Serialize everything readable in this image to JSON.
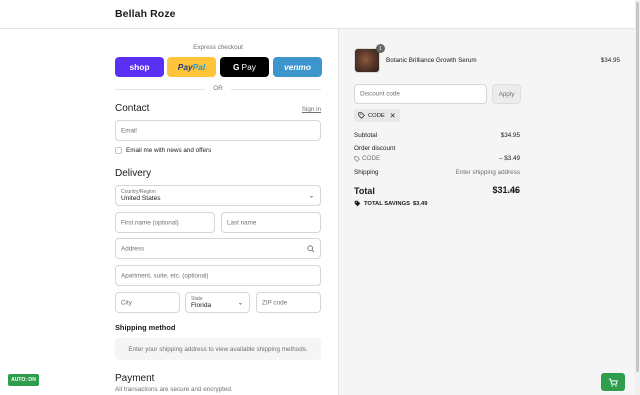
{
  "brand": "Bellah Roze",
  "express": {
    "label": "Express checkout",
    "shop": "shop",
    "paypal_pay": "Pay",
    "paypal_pal": "Pal",
    "gpay": "Pay",
    "venmo": "venmo",
    "or": "OR"
  },
  "contact": {
    "title": "Contact",
    "signin": "Sign in",
    "email_placeholder": "Email",
    "newsletter_label": "Email me with news and offers"
  },
  "delivery": {
    "title": "Delivery",
    "country_label": "Country/Region",
    "country_value": "United States",
    "first_name": "First name (optional)",
    "last_name": "Last name",
    "address": "Address",
    "apartment": "Apartment, suite, etc. (optional)",
    "city": "City",
    "state_label": "State",
    "state_value": "Florida",
    "zip": "ZIP code"
  },
  "shipping_method": {
    "title": "Shipping method",
    "message": "Enter your shipping address to view available shipping methods."
  },
  "payment": {
    "title": "Payment",
    "subtitle": "All transactions are secure and encrypted."
  },
  "auto_badge": "AUTO: ON",
  "summary": {
    "product": {
      "name": "Botanic Brilliance Growth Serum",
      "price": "$34.95",
      "quantity": "1"
    },
    "discount_placeholder": "Discount code",
    "apply": "Apply",
    "applied_code": "CODE",
    "subtotal_label": "Subtotal",
    "subtotal_value": "$34.95",
    "order_discount_label": "Order discount",
    "discount_code": "CODE",
    "discount_value": "– $3.49",
    "shipping_label": "Shipping",
    "shipping_value": "Enter shipping address",
    "total_label": "Total",
    "currency": "USD",
    "total_value": "$31.46",
    "savings_label": "TOTAL SAVINGS",
    "savings_value": "$3.49"
  },
  "colors": {
    "shop": "#5a31f4",
    "paypal": "#ffc439",
    "gpay": "#000000",
    "venmo": "#3d95ce",
    "auto_badge": "#2e9e4d"
  }
}
